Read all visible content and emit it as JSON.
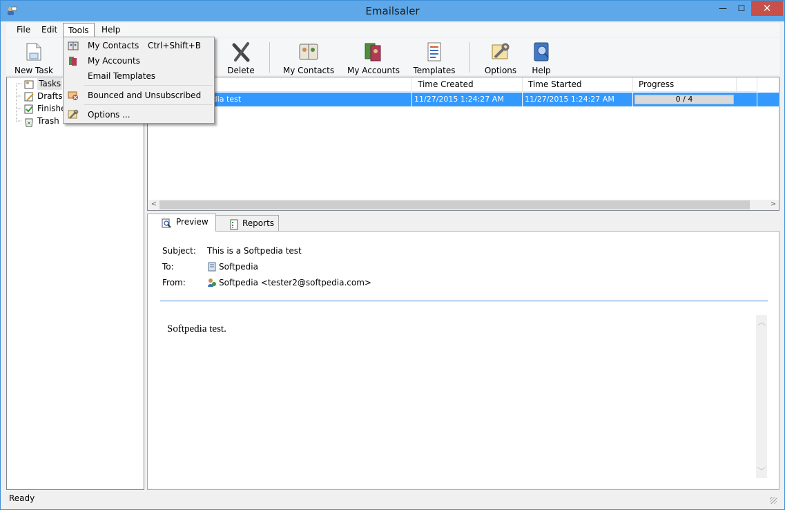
{
  "window": {
    "title": "Emailsaler",
    "minimize": "—",
    "maximize": "☐",
    "close": "✕"
  },
  "menu": {
    "items": [
      "File",
      "Edit",
      "Tools",
      "Help"
    ],
    "active": "Tools"
  },
  "tools_menu": {
    "items": [
      {
        "label": "My Contacts",
        "shortcut": "Ctrl+Shift+B",
        "icon": "contacts-book-icon"
      },
      {
        "label": "My Accounts",
        "icon": "accounts-icon"
      },
      {
        "label": "Email Templates",
        "icon": ""
      },
      {
        "label": "Bounced and Unsubscribed",
        "icon": "bounced-icon"
      },
      {
        "label": "Options ...",
        "icon": "options-icon"
      }
    ]
  },
  "toolbar": {
    "new_task": "New Task",
    "delete": "Delete",
    "my_contacts": "My Contacts",
    "my_accounts": "My Accounts",
    "templates": "Templates",
    "options": "Options",
    "help": "Help"
  },
  "tree": {
    "items": [
      "Tasks",
      "Drafts",
      "Finished",
      "Trash"
    ],
    "selected": "Tasks"
  },
  "grid": {
    "columns": [
      "",
      "Time Created",
      "Time Started",
      "Progress"
    ],
    "rows": [
      {
        "name_visible": "edia test",
        "created": "11/27/2015 1:24:27 AM",
        "started": "11/27/2015 1:24:27 AM",
        "progress_text": "0 / 4",
        "progress_fraction": 0
      }
    ]
  },
  "tabs": {
    "preview": "Preview",
    "reports": "Reports",
    "active": "Preview"
  },
  "preview": {
    "subject_label": "Subject:",
    "subject": "This is a Softpedia test",
    "to_label": "To:",
    "to": "Softpedia",
    "from_label": "From:",
    "from": "Softpedia <tester2@softpedia.com>",
    "body": "Softpedia test."
  },
  "status": {
    "text": "Ready"
  },
  "colors": {
    "titlebar": "#5ea8e9",
    "selection": "#3399ff",
    "close": "#c7504a",
    "divider": "#3d7fd1"
  }
}
